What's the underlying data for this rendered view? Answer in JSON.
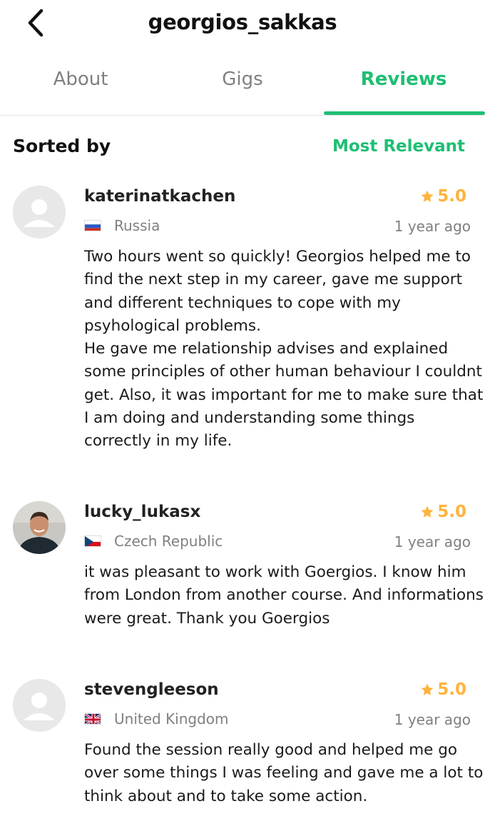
{
  "header": {
    "title": "georgios_sakkas",
    "back_icon": "chevron-left-icon"
  },
  "tabs": [
    {
      "label": "About",
      "active": false
    },
    {
      "label": "Gigs",
      "active": false
    },
    {
      "label": "Reviews",
      "active": true
    }
  ],
  "sort": {
    "label": "Sorted by",
    "value": "Most Relevant"
  },
  "colors": {
    "accent": "#1dbf73",
    "star": "#ffb33e",
    "muted": "#808080"
  },
  "reviews": [
    {
      "username": "katerinatkachen",
      "rating": "5.0",
      "country": "Russia",
      "flag": "russia-flag-icon",
      "time": "1 year ago",
      "text": "Two hours went so quickly! Georgios helped me to find the next step in my career, gave me support and different techniques to cope with my psyhological problems.\nHe gave me relationship advises and explained some principles of other human behaviour I couldnt get. Also, it was important for me to make sure that I am doing and understanding some things correctly in my life.",
      "avatar": "default-avatar-icon"
    },
    {
      "username": "lucky_lukasx",
      "rating": "5.0",
      "country": "Czech Republic",
      "flag": "czech-republic-flag-icon",
      "time": "1 year ago",
      "text": "it was pleasant to work with Goergios. I know him from London from another course. And informations were great. Thank you Goergios",
      "avatar": "user-photo"
    },
    {
      "username": "stevengleeson",
      "rating": "5.0",
      "country": "United Kingdom",
      "flag": "united-kingdom-flag-icon",
      "time": "1 year ago",
      "text": "Found the session really good and helped me go over some things I was feeling and gave me a lot to think about and to take some action.",
      "avatar": "default-avatar-icon"
    }
  ]
}
